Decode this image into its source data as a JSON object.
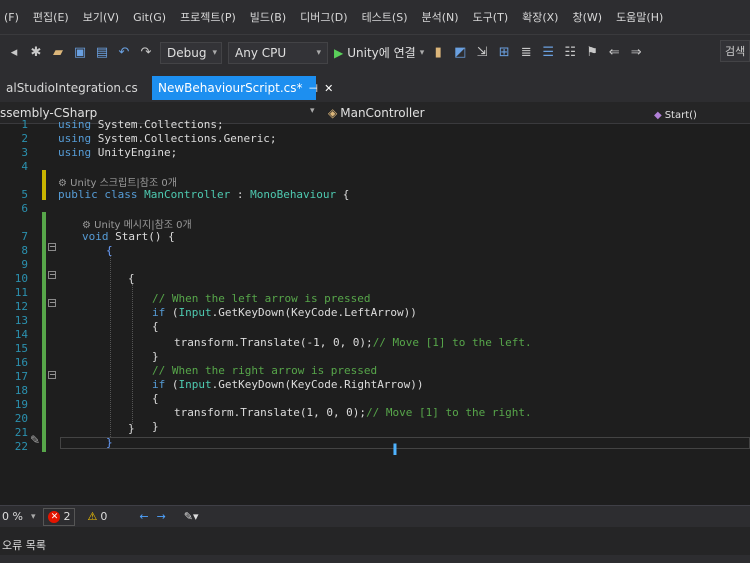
{
  "menu": [
    "(F)",
    "편집(E)",
    "보기(V)",
    "Git(G)",
    "프로젝트(P)",
    "빌드(B)",
    "디버그(D)",
    "테스트(S)",
    "분석(N)",
    "도구(T)",
    "확장(X)",
    "창(W)",
    "도움말(H)"
  ],
  "toolbar": {
    "config": "Debug",
    "platform": "Any CPU",
    "run_label": "Unity에 연결",
    "search_label": "검색"
  },
  "tabs": {
    "inactive_label": "alStudioIntegration.cs",
    "active_label": "NewBehaviourScript.cs*"
  },
  "nav": {
    "project": "ssembly-CSharp",
    "class": "ManController",
    "member": "Start()"
  },
  "code": {
    "line_numbers": [
      "1",
      "2",
      "3",
      "4",
      "5",
      "6",
      "7",
      "8",
      "9",
      "10",
      "11",
      "12",
      "13",
      "14",
      "15",
      "16",
      "17",
      "18",
      "19",
      "20",
      "21",
      "22"
    ],
    "using1_kw": "using",
    "using1_ns": " System.Collections;",
    "using2_kw": "using",
    "using2_ns": " System.Collections.Generic;",
    "using3_kw": "using",
    "using3_ns": " UnityEngine;",
    "lens_class": "Unity 스크립트|참조 0개",
    "class_public": "public",
    "class_kw": " class ",
    "class_name": "ManController",
    "class_colon": " : ",
    "class_base": "MonoBehaviour",
    "class_brace": " {",
    "lens_method": "Unity 메시지|참조 0개",
    "method_void": "void",
    "method_sig": " Start() {",
    "brace_open_1": "{",
    "brace_open_2": "{",
    "comment_left": "// When the left arrow is pressed",
    "if_kw_1": "if",
    "if_body_1a": " (",
    "input_1": "Input",
    "if_body_1b": ".GetKeyDown(KeyCode.LeftArrow))",
    "brace_open_3": "{",
    "translate_left": "transform.Translate(-1, 0, 0);",
    "comment_move_left": "// Move [1] to the left.",
    "brace_close_3": "}",
    "comment_right": "// When the right arrow is pressed",
    "if_kw_2": "if",
    "if_body_2a": " (",
    "input_2": "Input",
    "if_body_2b": ".GetKeyDown(KeyCode.RightArrow))",
    "brace_open_4": "{",
    "translate_right": "transform.Translate(1, 0, 0);",
    "comment_move_right": "// Move [1] to the right.",
    "brace_close_4": "}",
    "brace_close_2": "}",
    "brace_close_1": "}"
  },
  "status": {
    "zoom": "0 %",
    "errors": "2",
    "warnings": "0"
  },
  "bottom_panel": {
    "title": "오류 목록"
  },
  "colors": {
    "accent": "#1d8ff0",
    "keyword": "#569cd6",
    "type": "#4ec9b0",
    "comment": "#57a64a",
    "line_number": "#2b91af"
  }
}
